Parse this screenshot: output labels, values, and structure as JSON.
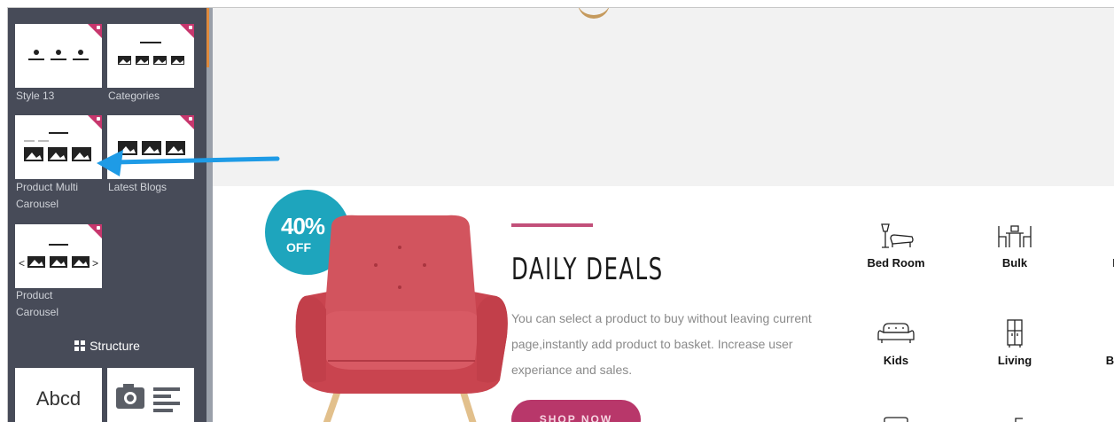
{
  "sidebar": {
    "tiles": [
      {
        "label": "Style 13"
      },
      {
        "label": "Categories"
      },
      {
        "label": "Product Multi Carousel"
      },
      {
        "label": "Latest Blogs"
      },
      {
        "label": "Product Carousel"
      }
    ],
    "section_title": "Structure",
    "structure_tiles": [
      {
        "label": "Abcd"
      },
      {
        "icon": "camera-text-icon"
      }
    ]
  },
  "deal": {
    "badge_percent": "40%",
    "badge_off": "OFF",
    "title": "DAILY DEALS",
    "description": "You can select a product to buy without leaving current page,instantly add product to basket. Increase user experiance and sales.",
    "button_label": "SHOP NOW"
  },
  "categories": [
    {
      "label": "Bed Room",
      "icon": "lamp-sofa-icon"
    },
    {
      "label": "Bulk",
      "icon": "dining-set-icon"
    },
    {
      "label": "D",
      "icon": "chair-icon"
    },
    {
      "label": "Kids",
      "icon": "sofa-icon"
    },
    {
      "label": "Living",
      "icon": "cabinet-icon"
    },
    {
      "label": "Bed",
      "icon": "bed-icon"
    }
  ],
  "colors": {
    "sidebar_bg": "#474b58",
    "badge": "#c7376d",
    "discount": "#1ea5bd",
    "accent": "#b8376a",
    "arrow": "#1e9be6",
    "chair": "#d2545e"
  }
}
